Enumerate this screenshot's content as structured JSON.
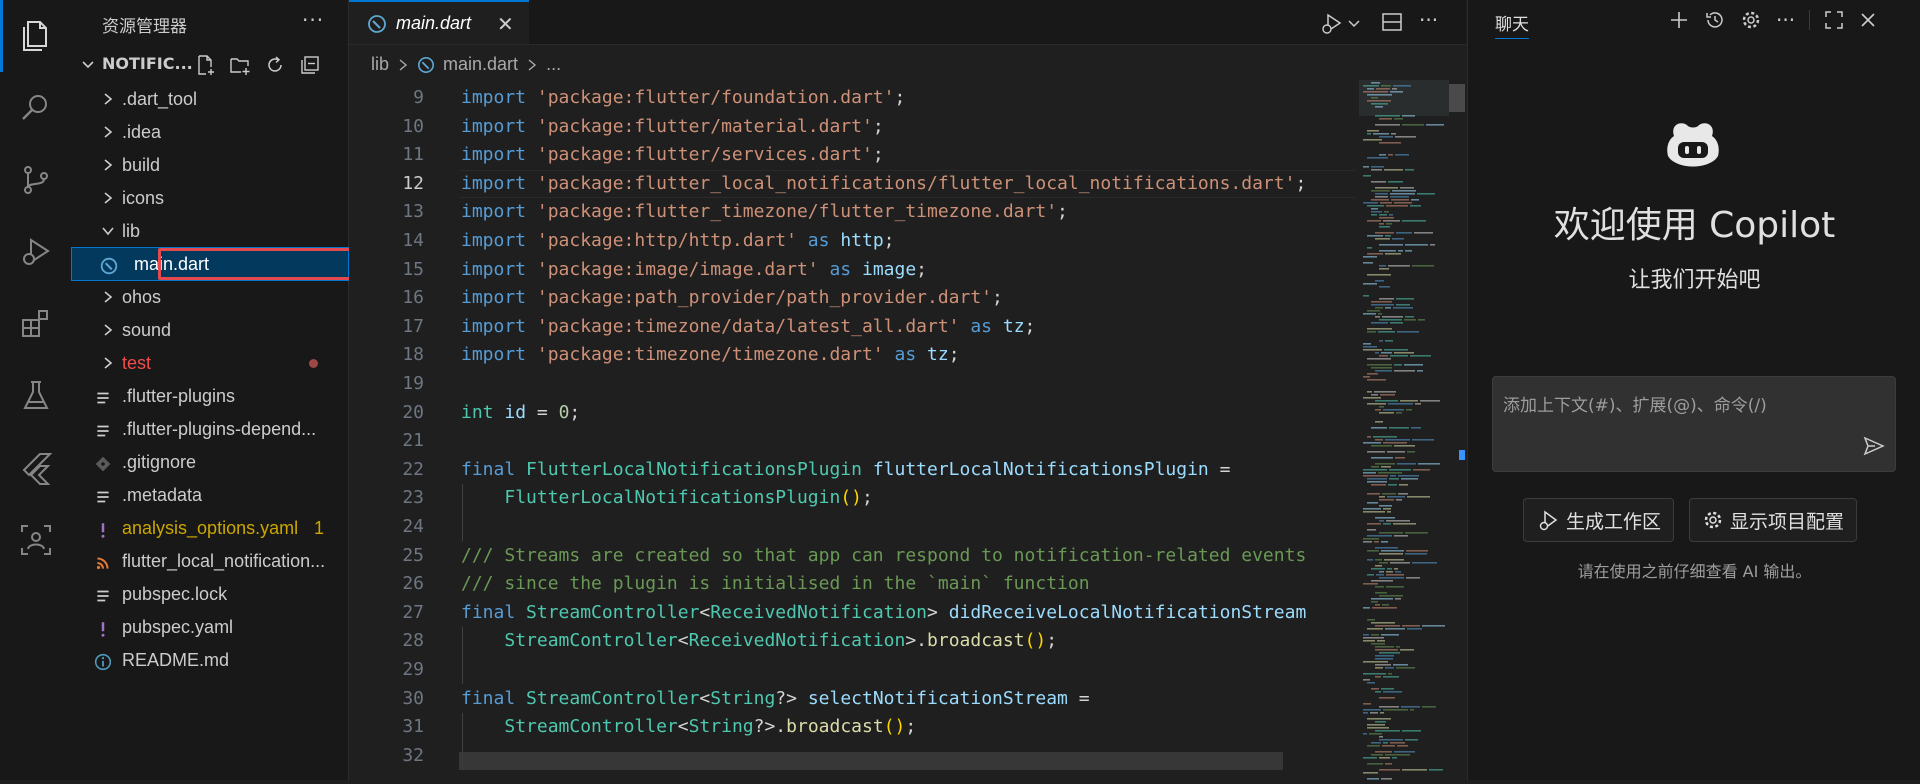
{
  "colors": {
    "accent": "#0078d4",
    "selection_bg": "#04395e",
    "highlight_box": "#e5484d",
    "error_text": "#f14c4c",
    "warning_text": "#cca700",
    "keyword": "#569cd6",
    "string": "#ce9178",
    "type": "#4ec9b0",
    "variable": "#9cdcfe",
    "function": "#dcdcaa",
    "number": "#b5cea8",
    "comment": "#6a9955"
  },
  "activity_bar": {
    "items": [
      {
        "icon": "files-icon",
        "active": true
      },
      {
        "icon": "search-icon"
      },
      {
        "icon": "source-control-icon"
      },
      {
        "icon": "run-debug-icon"
      },
      {
        "icon": "extensions-icon"
      },
      {
        "icon": "testing-icon"
      },
      {
        "icon": "flutter-icon"
      },
      {
        "icon": "remote-explorer-icon"
      }
    ]
  },
  "sidebar": {
    "title": "资源管理器",
    "more": "···",
    "project": "NOTIFIC...",
    "tree": [
      {
        "label": "dart_tool",
        "prefix": ".",
        "kind": "folder",
        "icon": "chevron-right-icon"
      },
      {
        "label": "idea",
        "prefix": ".",
        "kind": "folder",
        "icon": "chevron-right-icon"
      },
      {
        "label": "build",
        "prefix": "",
        "kind": "folder",
        "icon": "chevron-right-icon"
      },
      {
        "label": "icons",
        "prefix": "",
        "kind": "folder",
        "icon": "chevron-right-icon"
      },
      {
        "label": "lib",
        "prefix": "",
        "kind": "folder-open",
        "icon": "chevron-down-icon"
      },
      {
        "label": "main.dart",
        "prefix": "",
        "kind": "file-selected",
        "icon": "dart-file-icon"
      },
      {
        "label": "ohos",
        "prefix": "",
        "kind": "folder",
        "icon": "chevron-right-icon"
      },
      {
        "label": "sound",
        "prefix": "",
        "kind": "folder",
        "icon": "chevron-right-icon"
      },
      {
        "label": "test",
        "prefix": "",
        "kind": "folder-error",
        "icon": "chevron-right-icon"
      },
      {
        "label": ".flutter-plugins",
        "prefix": "",
        "kind": "file",
        "icon": "lines-file-icon"
      },
      {
        "label": ".flutter-plugins-depend...",
        "prefix": "",
        "kind": "file",
        "icon": "lines-file-icon"
      },
      {
        "label": ".gitignore",
        "prefix": "",
        "kind": "file",
        "icon": "gitignore-file-icon"
      },
      {
        "label": ".metadata",
        "prefix": "",
        "kind": "file",
        "icon": "lines-file-icon"
      },
      {
        "label": "analysis_options.yaml",
        "prefix": "",
        "kind": "file-warning",
        "icon": "yaml-file-icon",
        "badge": "1"
      },
      {
        "label": "flutter_local_notification...",
        "prefix": "",
        "kind": "file",
        "icon": "rss-file-icon"
      },
      {
        "label": "pubspec.lock",
        "prefix": "",
        "kind": "file",
        "icon": "lines-file-icon"
      },
      {
        "label": "pubspec.yaml",
        "prefix": "",
        "kind": "file",
        "icon": "yaml-file-icon"
      },
      {
        "label": "README.md",
        "prefix": "",
        "kind": "file",
        "icon": "info-file-icon"
      }
    ]
  },
  "editor": {
    "tab_label": "main.dart",
    "tab_close": "✕",
    "breadcrumb": [
      "lib",
      "main.dart",
      "..."
    ],
    "current_line": "12",
    "lines": [
      {
        "n": "9",
        "t": [
          [
            "kw",
            "import "
          ],
          [
            "str",
            "'package:flutter/foundation.dart'"
          ],
          [
            "pl",
            ";"
          ]
        ]
      },
      {
        "n": "10",
        "t": [
          [
            "kw",
            "import "
          ],
          [
            "str",
            "'package:flutter/material.dart'"
          ],
          [
            "pl",
            ";"
          ]
        ]
      },
      {
        "n": "11",
        "t": [
          [
            "kw",
            "import "
          ],
          [
            "str",
            "'package:flutter/services.dart'"
          ],
          [
            "pl",
            ";"
          ]
        ]
      },
      {
        "n": "12",
        "t": [
          [
            "kw",
            "import "
          ],
          [
            "str",
            "'package:flutter_local_notifications/flutter_local_notifications.dart'"
          ],
          [
            "pl",
            ";"
          ]
        ]
      },
      {
        "n": "13",
        "t": [
          [
            "kw",
            "import "
          ],
          [
            "str",
            "'package:flutter_timezone/flutter_timezone.dart'"
          ],
          [
            "pl",
            ";"
          ]
        ]
      },
      {
        "n": "14",
        "t": [
          [
            "kw",
            "import "
          ],
          [
            "str",
            "'package:http/http.dart'"
          ],
          [
            "kw",
            " as "
          ],
          [
            "var",
            "http"
          ],
          [
            "pl",
            ";"
          ]
        ]
      },
      {
        "n": "15",
        "t": [
          [
            "kw",
            "import "
          ],
          [
            "str",
            "'package:image/image.dart'"
          ],
          [
            "kw",
            " as "
          ],
          [
            "var",
            "image"
          ],
          [
            "pl",
            ";"
          ]
        ]
      },
      {
        "n": "16",
        "t": [
          [
            "kw",
            "import "
          ],
          [
            "str",
            "'package:path_provider/path_provider.dart'"
          ],
          [
            "pl",
            ";"
          ]
        ]
      },
      {
        "n": "17",
        "t": [
          [
            "kw",
            "import "
          ],
          [
            "str",
            "'package:timezone/data/latest_all.dart'"
          ],
          [
            "kw",
            " as "
          ],
          [
            "var",
            "tz"
          ],
          [
            "pl",
            ";"
          ]
        ]
      },
      {
        "n": "18",
        "t": [
          [
            "kw",
            "import "
          ],
          [
            "str",
            "'package:timezone/timezone.dart'"
          ],
          [
            "kw",
            " as "
          ],
          [
            "var",
            "tz"
          ],
          [
            "pl",
            ";"
          ]
        ]
      },
      {
        "n": "19",
        "t": []
      },
      {
        "n": "20",
        "t": [
          [
            "ty",
            "int "
          ],
          [
            "var",
            "id"
          ],
          [
            "pl",
            " = "
          ],
          [
            "num",
            "0"
          ],
          [
            "pl",
            ";"
          ]
        ]
      },
      {
        "n": "21",
        "t": []
      },
      {
        "n": "22",
        "t": [
          [
            "kw",
            "final "
          ],
          [
            "ty",
            "FlutterLocalNotificationsPlugin "
          ],
          [
            "var",
            "flutterLocalNotificationsPlugin"
          ],
          [
            "pl",
            " ="
          ]
        ]
      },
      {
        "n": "23",
        "t": [
          [
            "pl",
            "    "
          ],
          [
            "ty",
            "FlutterLocalNotificationsPlugin"
          ],
          [
            "br",
            "()"
          ],
          [
            "pl",
            ";"
          ]
        ]
      },
      {
        "n": "24",
        "t": []
      },
      {
        "n": "25",
        "t": [
          [
            "cm",
            "/// Streams are created so that app can respond to notification-related events"
          ]
        ]
      },
      {
        "n": "26",
        "t": [
          [
            "cm",
            "/// since the plugin is initialised in the `main` function"
          ]
        ]
      },
      {
        "n": "27",
        "t": [
          [
            "kw",
            "final "
          ],
          [
            "ty",
            "StreamController"
          ],
          [
            "pl",
            "<"
          ],
          [
            "ty",
            "ReceivedNotification"
          ],
          [
            "pl",
            "> "
          ],
          [
            "var",
            "didReceiveLocalNotificationStream"
          ]
        ]
      },
      {
        "n": "28",
        "t": [
          [
            "pl",
            "    "
          ],
          [
            "ty",
            "StreamController"
          ],
          [
            "pl",
            "<"
          ],
          [
            "ty",
            "ReceivedNotification"
          ],
          [
            "pl",
            ">."
          ],
          [
            "fn",
            "broadcast"
          ],
          [
            "br",
            "()"
          ],
          [
            "pl",
            ";"
          ]
        ]
      },
      {
        "n": "29",
        "t": []
      },
      {
        "n": "30",
        "t": [
          [
            "kw",
            "final "
          ],
          [
            "ty",
            "StreamController"
          ],
          [
            "pl",
            "<"
          ],
          [
            "ty",
            "String"
          ],
          [
            "pl",
            "?> "
          ],
          [
            "var",
            "selectNotificationStream"
          ],
          [
            "pl",
            " ="
          ]
        ]
      },
      {
        "n": "31",
        "t": [
          [
            "pl",
            "    "
          ],
          [
            "ty",
            "StreamController"
          ],
          [
            "pl",
            "<"
          ],
          [
            "ty",
            "String"
          ],
          [
            "pl",
            "?>."
          ],
          [
            "fn",
            "broadcast"
          ],
          [
            "br",
            "()"
          ],
          [
            "pl",
            ";"
          ]
        ]
      },
      {
        "n": "32",
        "t": []
      }
    ]
  },
  "chat": {
    "tab": "聊天",
    "welcome_title": "欢迎使用 Copilot",
    "welcome_sub": "让我们开始吧",
    "input_placeholder": "添加上下文(#)、扩展(@)、命令(/)",
    "buttons": [
      {
        "label": "生成工作区",
        "icon": "debug-sparkle-icon"
      },
      {
        "label": "显示项目配置",
        "icon": "gear-icon"
      }
    ],
    "hint": "请在使用之前仔细查看 AI 输出。"
  }
}
